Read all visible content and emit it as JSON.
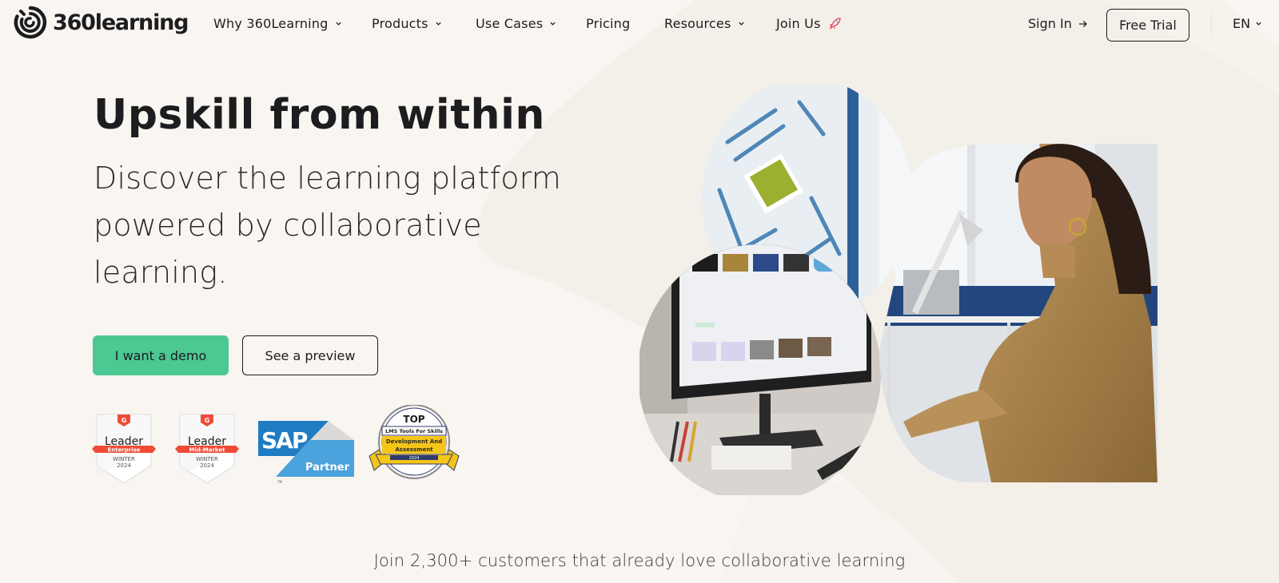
{
  "brand": {
    "name": "360learning",
    "accent_color": "#4cc893",
    "text_color": "#1d1d1f",
    "background_color": "#f9f5f1"
  },
  "nav": {
    "items": [
      {
        "label": "Why 360Learning",
        "has_dropdown": true
      },
      {
        "label": "Products",
        "has_dropdown": true
      },
      {
        "label": "Use Cases",
        "has_dropdown": true
      },
      {
        "label": "Pricing",
        "has_dropdown": false
      },
      {
        "label": "Resources",
        "has_dropdown": true
      },
      {
        "label": "Join Us",
        "has_dropdown": false,
        "icon": "rocket-icon"
      }
    ],
    "sign_in": "Sign In",
    "sign_in_icon": "arrow-right-icon",
    "free_trial": "Free Trial",
    "language": "EN"
  },
  "hero": {
    "title": "Upskill from within",
    "subtitle_lines": [
      "Discover the learning platform",
      "powered by collaborative",
      "learning."
    ],
    "primary_cta": "I want a demo",
    "secondary_cta": "See a preview",
    "image_alt": "Woman working at a desk beside a monitor showing the 360Learning platform"
  },
  "badges": [
    {
      "type": "g2",
      "title": "Leader",
      "ribbon": "Enterprise",
      "season": "WINTER",
      "year": "2024"
    },
    {
      "type": "g2",
      "title": "Leader",
      "ribbon": "Mid-Market",
      "season": "WINTER",
      "year": "2024"
    },
    {
      "type": "sap",
      "logo": "SAP",
      "label": "Partner",
      "tm": "TM"
    },
    {
      "type": "award",
      "top": "TOP",
      "line1": "LMS Tools For Skills",
      "line2": "Development And",
      "line3": "Assessment",
      "year": "2024"
    }
  ],
  "social_proof": "Join 2,300+ customers that already love collaborative learning"
}
